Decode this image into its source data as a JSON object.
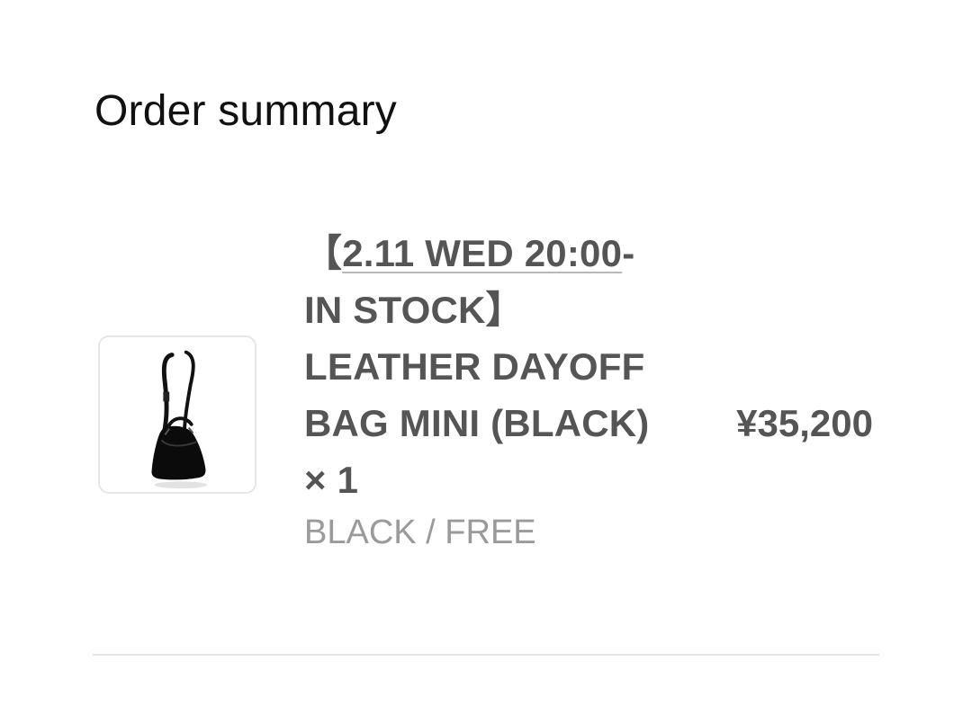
{
  "summary": {
    "title": "Order summary"
  },
  "item": {
    "name_prefix": "【",
    "name_linked": "2.11 WED 20:00",
    "name_rest": "- IN STOCK】 LEATHER DAYOFF BAG MINI (BLACK) × 1",
    "variant": "BLACK / FREE",
    "price": "¥35,200",
    "thumbnail": "black-leather-bag-with-strap"
  },
  "colors": {
    "text": "#111111",
    "product_text": "#555555",
    "variant_text": "#9a9a9a",
    "border": "#e6e6e6",
    "divider": "#e5e5e5"
  }
}
